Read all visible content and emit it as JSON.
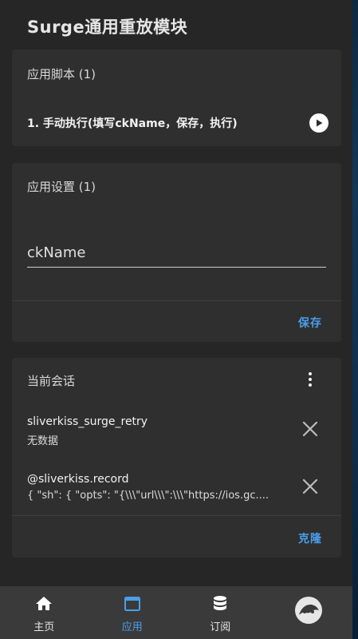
{
  "header": {
    "title": "Surge通用重放模块"
  },
  "scripts_card": {
    "title": "应用脚本 (1)",
    "items": [
      {
        "label": "1. 手动执行(填写ckName，保存，执行)"
      }
    ]
  },
  "settings_card": {
    "title": "应用设置 (1)",
    "field_placeholder": "ckName",
    "field_value": "",
    "save_label": "保存"
  },
  "session_card": {
    "title": "当前会话",
    "items": [
      {
        "name": "sliverkiss_surge_retry",
        "value": "无数据"
      },
      {
        "name": "@sliverkiss.record",
        "value": "{ \"sh\": { \"opts\": \"{\\\\\\\"url\\\\\\\":\\\\\\\"https://ios.gc...."
      }
    ],
    "clone_label": "克隆"
  },
  "bottom_nav": {
    "items": [
      {
        "label": "主页",
        "icon": "home-icon"
      },
      {
        "label": "应用",
        "icon": "app-window-icon",
        "active": true
      },
      {
        "label": "订阅",
        "icon": "database-icon"
      },
      {
        "label": "",
        "icon": "avatar-icon"
      }
    ]
  },
  "colors": {
    "accent": "#4a9eea",
    "card": "#2f2f2f",
    "background": "#262626",
    "nav": "#3a3a3a"
  }
}
